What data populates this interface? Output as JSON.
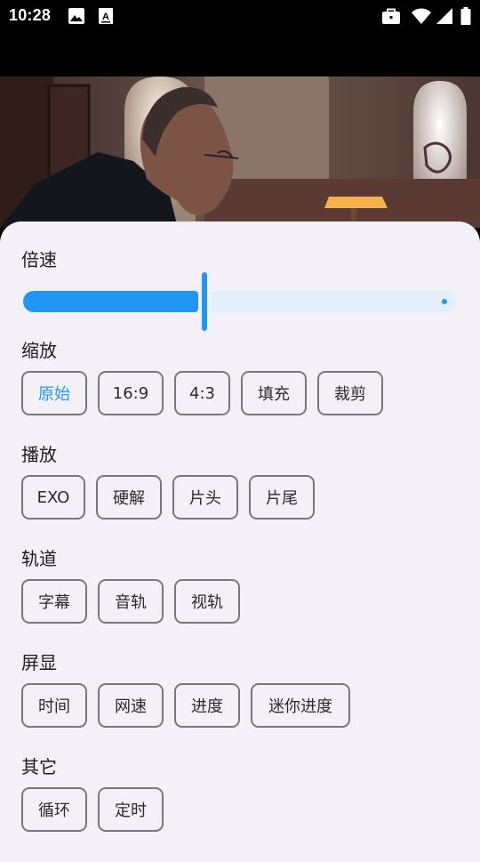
{
  "status_bar": {
    "time": "10:28",
    "left_icons": [
      "image-icon",
      "a-badge-icon"
    ],
    "right_icons": [
      "briefcase-icon",
      "wifi-icon",
      "signal-icon",
      "battery-icon"
    ]
  },
  "colors": {
    "accent": "#2196f3",
    "sheet_bg": "#f4f0f8",
    "chip_border": "#7a757f",
    "text": "#1c1b1f"
  },
  "speed": {
    "title": "倍速",
    "slider_value": 0.42
  },
  "scale": {
    "title": "缩放",
    "options": [
      "原始",
      "16:9",
      "4:3",
      "填充",
      "裁剪"
    ],
    "selected": "原始"
  },
  "playback": {
    "title": "播放",
    "options": [
      "EXO",
      "硬解",
      "片头",
      "片尾"
    ]
  },
  "track": {
    "title": "轨道",
    "options": [
      "字幕",
      "音轨",
      "视轨"
    ]
  },
  "display": {
    "title": "屏显",
    "options": [
      "时间",
      "网速",
      "进度",
      "迷你进度"
    ]
  },
  "other": {
    "title": "其它",
    "options": [
      "循环",
      "定时"
    ]
  }
}
